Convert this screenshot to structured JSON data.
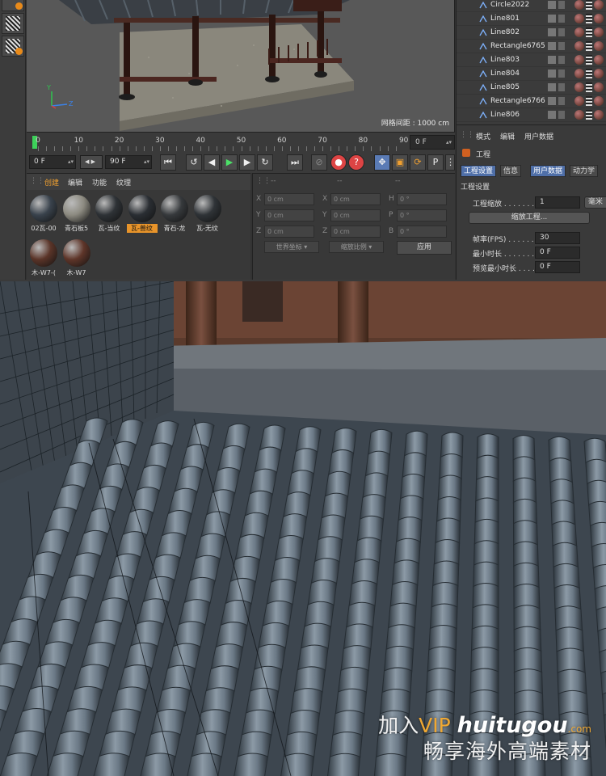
{
  "viewport": {
    "grid_label": "网格间距 : 1000 cm",
    "axis_y": "Y",
    "axis_z": "Z"
  },
  "timeline": {
    "ticks": [
      "0",
      "10",
      "20",
      "30",
      "40",
      "50",
      "60",
      "70",
      "80",
      "90"
    ],
    "current_frame": "0 F"
  },
  "transport": {
    "start_frame": "0 F",
    "end_frame": "90 F"
  },
  "materials": {
    "menu": [
      "创建",
      "编辑",
      "功能",
      "纹理"
    ],
    "items": [
      {
        "label": "02瓦-00",
        "color": "#39424c"
      },
      {
        "label": "青石板5",
        "color": "#8c8a80"
      },
      {
        "label": "瓦-当纹",
        "color": "#2e3236"
      },
      {
        "label": "瓦-兽纹",
        "color": "#2a2e33"
      },
      {
        "label": "青石-龙",
        "color": "#36393c"
      },
      {
        "label": "瓦-无纹",
        "color": "#2f3337"
      },
      {
        "label": "木-W7-(",
        "color": "#5a3428"
      },
      {
        "label": "木-W7",
        "color": "#5e3529"
      }
    ]
  },
  "coordinates": {
    "headers": [
      "--",
      "--",
      "--"
    ],
    "rows": [
      {
        "a": "X",
        "av": "0 cm",
        "b": "X",
        "bv": "0 cm",
        "c": "H",
        "cv": "0 °"
      },
      {
        "a": "Y",
        "av": "0 cm",
        "b": "Y",
        "bv": "0 cm",
        "c": "P",
        "cv": "0 °"
      },
      {
        "a": "Z",
        "av": "0 cm",
        "b": "Z",
        "bv": "0 cm",
        "c": "B",
        "cv": "0 °"
      }
    ],
    "mode1": "世界坐标",
    "mode2": "缩放比例",
    "apply": "应用"
  },
  "objects": [
    "Circle2022",
    "Line801",
    "Line802",
    "Rectangle6765",
    "Line803",
    "Line804",
    "Line805",
    "Rectangle6766",
    "Line806"
  ],
  "attributes": {
    "menu": [
      "模式",
      "编辑",
      "用户数据"
    ],
    "object_name": "工程",
    "tabs": [
      "工程设置",
      "信息",
      "用户数据",
      "动力学"
    ],
    "section": "工程设置",
    "scale_label": "工程缩放 . . . . . . .",
    "scale_value": "1",
    "scale_unit": "毫米",
    "scale_button": "缩放工程...",
    "fps_label": "帧率(FPS) . . . . . .",
    "fps_value": "30",
    "min_time_label": "最小时长 . . . . . . .",
    "min_time_value": "0 F",
    "preview_min_label": "预览最小时长 . . . .",
    "preview_min_value": "0 F"
  },
  "watermark": {
    "prefix": "加入",
    "vip": "VIP",
    "brand": "huitugou",
    "com": ".com",
    "line2": "畅享海外高端素材"
  }
}
